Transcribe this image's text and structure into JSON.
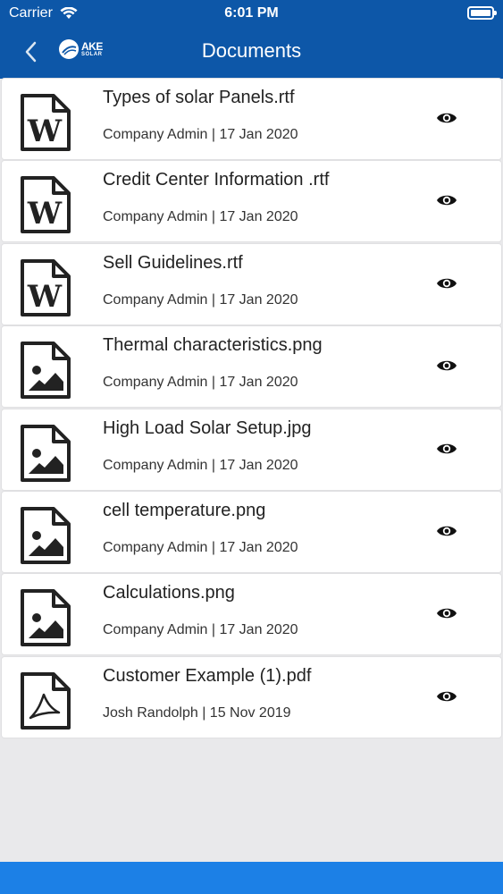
{
  "status_bar": {
    "carrier": "Carrier",
    "time": "6:01 PM"
  },
  "nav": {
    "title": "Documents",
    "logo_main": "AKE",
    "logo_sub": "SOLAR"
  },
  "documents": [
    {
      "name": "Types of solar Panels.rtf",
      "meta": "Company Admin | 17 Jan 2020",
      "icon": "word-document-icon"
    },
    {
      "name": "Credit Center Information .rtf",
      "meta": "Company Admin | 17 Jan 2020",
      "icon": "word-document-icon"
    },
    {
      "name": "Sell Guidelines.rtf",
      "meta": "Company Admin | 17 Jan 2020",
      "icon": "word-document-icon"
    },
    {
      "name": "Thermal characteristics.png",
      "meta": "Company Admin | 17 Jan 2020",
      "icon": "image-file-icon"
    },
    {
      "name": "High Load Solar Setup.jpg",
      "meta": "Company Admin | 17 Jan 2020",
      "icon": "image-file-icon"
    },
    {
      "name": "cell temperature.png",
      "meta": "Company Admin | 17 Jan 2020",
      "icon": "image-file-icon"
    },
    {
      "name": "Calculations.png",
      "meta": "Company Admin | 17 Jan 2020",
      "icon": "image-file-icon"
    },
    {
      "name": "Customer Example (1).pdf",
      "meta": "Josh Randolph | 15 Nov 2019",
      "icon": "pdf-file-icon"
    }
  ],
  "colors": {
    "header": "#0d57a8",
    "bottom_bar": "#1c80e6",
    "background": "#e9e9eb"
  }
}
